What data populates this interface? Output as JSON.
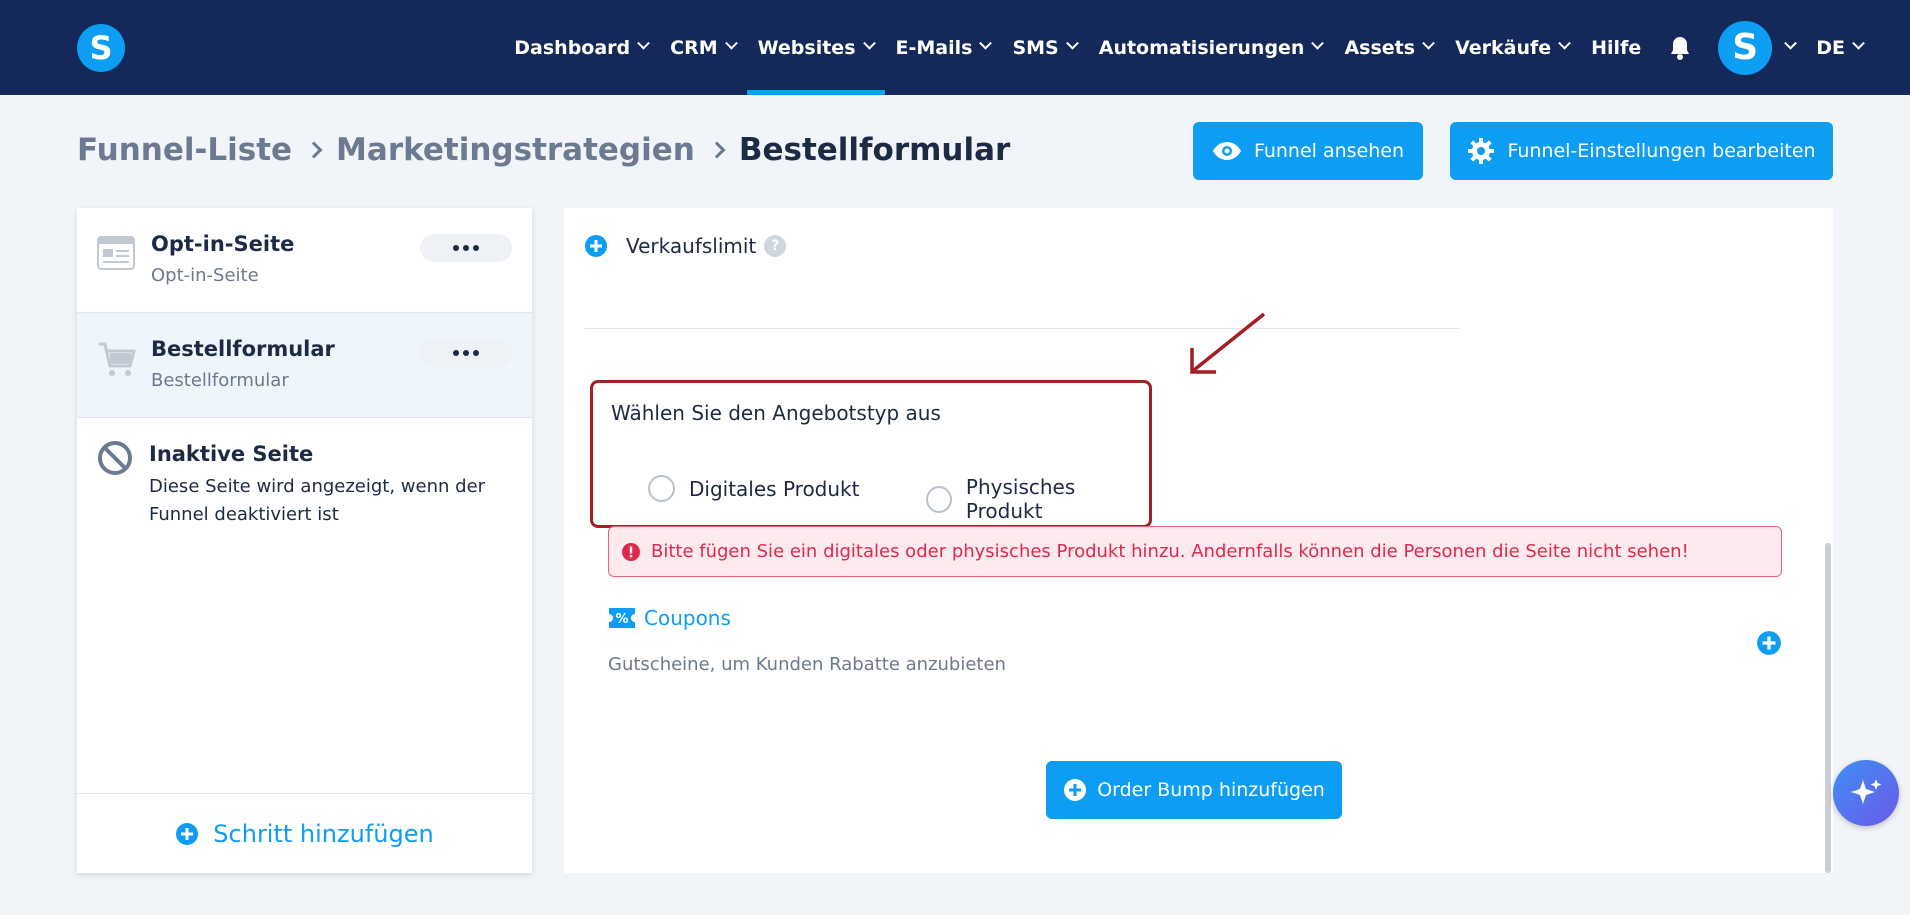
{
  "nav": {
    "items": [
      {
        "label": "Dashboard",
        "dropdown": true
      },
      {
        "label": "CRM",
        "dropdown": true
      },
      {
        "label": "Websites",
        "dropdown": true,
        "active": true
      },
      {
        "label": "E-Mails",
        "dropdown": true
      },
      {
        "label": "SMS",
        "dropdown": true
      },
      {
        "label": "Automatisierungen",
        "dropdown": true
      },
      {
        "label": "Assets",
        "dropdown": true
      },
      {
        "label": "Verkäufe",
        "dropdown": true
      },
      {
        "label": "Hilfe",
        "dropdown": false
      }
    ],
    "logo_letter": "S",
    "avatar_letter": "S",
    "language": "DE",
    "accent_color": "#0d9df2",
    "bar_color": "#14285a"
  },
  "breadcrumb": [
    "Funnel-Liste",
    "Marketingstrategien",
    "Bestellformular"
  ],
  "header_buttons": {
    "view_label": "Funnel ansehen",
    "settings_label": "Funnel-Einstellungen bearbeiten"
  },
  "sidebar": {
    "steps": [
      {
        "title": "Opt-in-Seite",
        "subtitle": "Opt-in-Seite",
        "icon": "page-icon"
      },
      {
        "title": "Bestellformular",
        "subtitle": "Bestellformular",
        "icon": "cart-icon",
        "active": true
      }
    ],
    "inactive": {
      "title": "Inaktive Seite",
      "description": "Diese Seite wird angezeigt, wenn der Funnel deaktiviert ist",
      "icon": "disabled-icon"
    },
    "add_step_label": "Schritt hinzufügen"
  },
  "main": {
    "sales_limit_label": "Verkaufslimit",
    "help_mark": "?",
    "offer_type": {
      "title": "Wählen Sie den Angebotstyp aus",
      "options": [
        "Digitales Produkt",
        "Physisches Produkt"
      ]
    },
    "alert_text": "Bitte fügen Sie ein digitales oder physisches Produkt hinzu. Andernfalls können die Personen die Seite nicht sehen!",
    "coupons": {
      "title": "Coupons",
      "description": "Gutscheine, um Kunden Rabatte anzubieten"
    },
    "order_bump_label": "Order Bump hinzufügen"
  }
}
